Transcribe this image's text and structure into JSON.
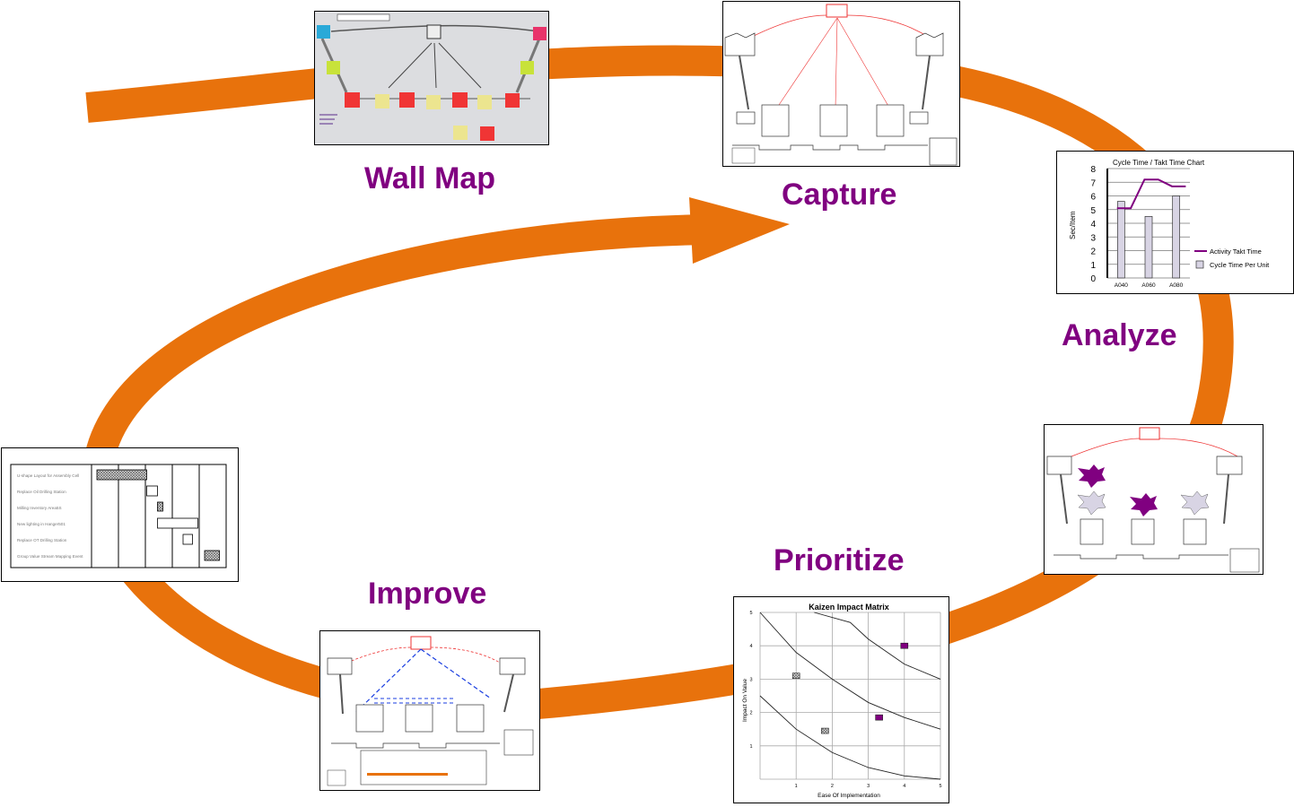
{
  "colors": {
    "arrow": "#E8720C",
    "label": "#800080",
    "series_line": "#800080",
    "bar_fill": "#D8D4E4"
  },
  "stages": {
    "wall_map": "Wall Map",
    "capture": "Capture",
    "analyze": "Analyze",
    "prioritize": "Prioritize",
    "improve": "Improve"
  },
  "chart_data": [
    {
      "type": "bar",
      "title": "Cycle Time / Takt Time Chart",
      "ylabel": "Sec/Item",
      "xlabel": "",
      "ylim": [
        0,
        8
      ],
      "yticks": [
        "0",
        "1",
        "2",
        "3",
        "4",
        "5",
        "6",
        "7",
        "8"
      ],
      "categories": [
        "A040",
        "A060",
        "A080"
      ],
      "grid": true,
      "legend_placement": "right",
      "series": [
        {
          "name": "Activity Takt Time",
          "type": "line",
          "points": [
            [
              -0.15,
              5.1
            ],
            [
              0.35,
              5.1
            ],
            [
              0.85,
              7.2
            ],
            [
              1.35,
              7.2
            ],
            [
              1.85,
              6.7
            ],
            [
              2.35,
              6.7
            ]
          ]
        },
        {
          "name": "Cycle Time Per Unit",
          "type": "bar",
          "values": [
            5.6,
            4.5,
            6.0
          ]
        }
      ]
    },
    {
      "type": "scatter",
      "title": "Kaizen Impact Matrix",
      "xlabel": "Ease Of Implementation",
      "ylabel": "Impact On Value",
      "xlim": [
        0,
        5
      ],
      "ylim": [
        0,
        5
      ],
      "xticks": [
        "1",
        "2",
        "3",
        "4",
        "5"
      ],
      "yticks": [
        "1",
        "2",
        "3",
        "4",
        "5"
      ],
      "grid": true,
      "points": [
        {
          "x": 1.0,
          "y": 3.1,
          "style": "hatched"
        },
        {
          "x": 1.8,
          "y": 1.45,
          "style": "hatched"
        },
        {
          "x": 3.3,
          "y": 1.85,
          "style": "purple"
        },
        {
          "x": 4.0,
          "y": 4.0,
          "style": "purple"
        }
      ],
      "curves": [
        [
          [
            0,
            2.5
          ],
          [
            1,
            1.5
          ],
          [
            2,
            0.8
          ],
          [
            3,
            0.35
          ],
          [
            4,
            0.1
          ],
          [
            5,
            0
          ]
        ],
        [
          [
            0,
            5
          ],
          [
            1,
            3.8
          ],
          [
            2,
            3
          ],
          [
            3,
            2.3
          ],
          [
            4,
            1.85
          ],
          [
            5,
            1.5
          ]
        ],
        [
          [
            1.5,
            5
          ],
          [
            2.5,
            4.7
          ],
          [
            3,
            4.2
          ],
          [
            4,
            3.45
          ],
          [
            5,
            3
          ]
        ]
      ]
    },
    {
      "type": "table",
      "tasks": [
        {
          "name": "U-shape Layout for Assembly Cell",
          "start": 0.2,
          "end": 2.05,
          "style": "hatched"
        },
        {
          "name": "Replace Oil Drilling Station",
          "start": 2.05,
          "end": 2.45,
          "style": "open"
        },
        {
          "name": "Milling Inventory Area5S",
          "start": 2.45,
          "end": 2.65,
          "style": "hatched"
        },
        {
          "name": "New lighting in Hanger501",
          "start": 2.45,
          "end": 3.95,
          "style": "open"
        },
        {
          "name": "Replace OT Drilling Station",
          "start": 3.4,
          "end": 3.75,
          "style": "open"
        },
        {
          "name": "Group Value Stream Mapping Event",
          "start": 4.2,
          "end": 4.75,
          "style": "hatched"
        }
      ],
      "columns": 5
    }
  ]
}
